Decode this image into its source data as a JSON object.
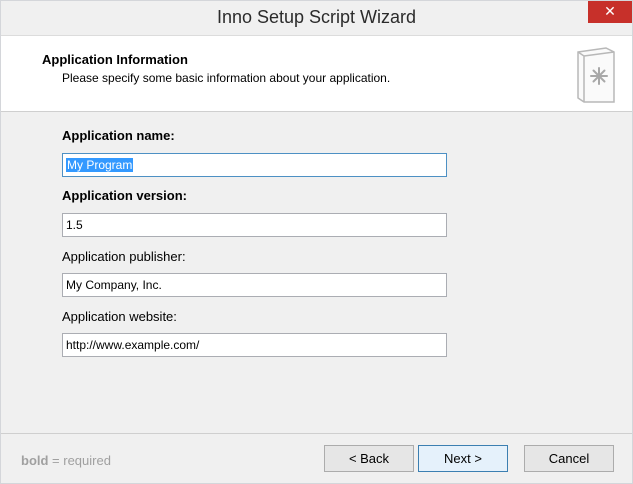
{
  "window": {
    "title": "Inno Setup Script Wizard",
    "close_symbol": "✕"
  },
  "header": {
    "title": "Application Information",
    "subtitle": "Please specify some basic information about your application.",
    "icon": "setup-package-icon"
  },
  "fields": [
    {
      "label": "Application name:",
      "value": "My Program",
      "required": true
    },
    {
      "label": "Application version:",
      "value": "1.5",
      "required": true
    },
    {
      "label": "Application publisher:",
      "value": "My Company, Inc.",
      "required": false
    },
    {
      "label": "Application website:",
      "value": "http://www.example.com/",
      "required": false
    }
  ],
  "footer": {
    "hint_bold": "bold",
    "hint_rest": " = required",
    "back_label": "< Back",
    "next_label": "Next >",
    "cancel_label": "Cancel"
  },
  "colors": {
    "selection": "#3399ff",
    "close_button": "#c7302a",
    "default_button_border": "#3c7fb1"
  }
}
